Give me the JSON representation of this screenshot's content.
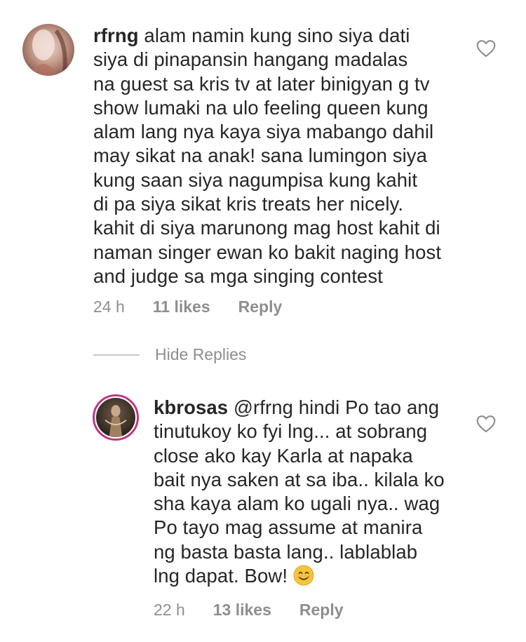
{
  "comments": [
    {
      "username": "rfrng",
      "text": "alam namin kung sino siya dati\nsiya  di pinapansin hangang madalas\nna guest sa kris tv at later binigyan g tv\nshow lumaki na ulo feeling queen kung\nalam lang nya kaya siya mabango dahil\nmay sikat na anak! sana lumingon siya\nkung saan siya nagumpisa kung kahit\ndi pa siya sikat kris treats her nicely.\nkahit di siya marunong mag host kahit di\nnaman singer ewan ko bakit naging host\nand judge sa mga singing contest",
      "time": "24 h",
      "likes": "11 likes",
      "reply": "Reply"
    },
    {
      "username": "kbrosas",
      "mention": "@rfrng",
      "text": "hindi Po tao ang\ntinutukoy ko fyi lng... at sobrang\nclose ako kay Karla at napaka\nbait nya saken at sa iba.. kilala ko\nsha kaya alam ko ugali nya.. wag\nPo tayo mag assume at manira\nng basta basta lang.. lablablab\nlng dapat. Bow! ",
      "emoji": "smiling-face-emoji",
      "time": "22 h",
      "likes": "13 likes",
      "reply": "Reply"
    }
  ],
  "hide_replies_label": "Hide Replies",
  "colors": {
    "text": "#262626",
    "secondary": "#8e8e8e",
    "story_ring": "#c13584"
  }
}
